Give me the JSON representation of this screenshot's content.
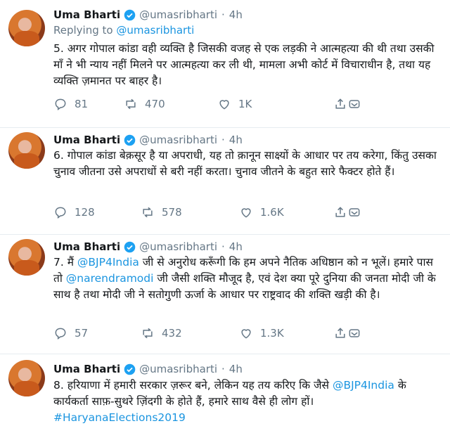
{
  "tweets": [
    {
      "author": "Uma Bharti",
      "handle": "@umasribharti",
      "separator": "·",
      "time": "4h",
      "replying_label": "Replying to",
      "replying_handle": "@umasribharti",
      "text": "5. अगर गोपाल कांडा वही व्यक्ति है जिसकी वजह से एक लड़की ने आत्महत्या की थी तथा उसकी माँ ने भी न्याय नहीं मिलने पर आत्महत्या कर ली थी, मामला अभी कोर्ट में विचाराधीन है, तथा यह व्यक्ति ज़मानत पर बाहर है।",
      "replies": "81",
      "retweets": "470",
      "likes": "1K"
    },
    {
      "author": "Uma Bharti",
      "handle": "@umasribharti",
      "separator": "·",
      "time": "4h",
      "text": "6. गोपाल कांडा बेक़सूर है या अपराधी, यह तो क़ानून साक्ष्यों के आधार पर तय करेगा, किंतु उसका चुनाव जीतना उसे अपराधों से बरी नहीं करता। चुनाव जीतने के बहुत सारे फैक्टर होते हैं।",
      "replies": "128",
      "retweets": "578",
      "likes": "1.6K"
    },
    {
      "author": "Uma Bharti",
      "handle": "@umasribharti",
      "separator": "·",
      "time": "4h",
      "text_part1": "7. मैं ",
      "link1": "@BJP4India",
      "text_part2": " जी से अनुरोध करूँगी कि हम अपने नैतिक अधिष्ठान को न भूलें। हमारे पास तो ",
      "link2": "@narendramodi",
      "text_part3": " जी जैसी शक्ति मौजूद है, एवं देश क्या पूरे दुनिया की जनता मोदी जी के साथ है तथा मोदी जी ने सतोगुणी ऊर्जा के आधार पर राष्ट्रवाद की शक्ति खड़ी की है।",
      "replies": "57",
      "retweets": "432",
      "likes": "1.3K"
    },
    {
      "author": "Uma Bharti",
      "handle": "@umasribharti",
      "separator": "·",
      "time": "4h",
      "text_part1": "8. हरियाणा में हमारी सरकार ज़रूर बने, लेकिन यह तय करिए कि जैसे ",
      "link1": "@BJP4India",
      "text_part2": " के कार्यकर्ता साफ़-सुथरे ज़िंदगी के होते हैं, हमारे साथ वैसे ही लोग हों।",
      "hashtag": "#HaryanaElections2019"
    }
  ],
  "colors": {
    "link": "#1b95e0",
    "muted": "#657786",
    "verified": "#1da1f2",
    "divider": "#e6ecf0"
  },
  "icons": [
    "reply-icon",
    "retweet-icon",
    "like-icon",
    "share-icon",
    "dm-icon",
    "verified-badge-icon"
  ]
}
